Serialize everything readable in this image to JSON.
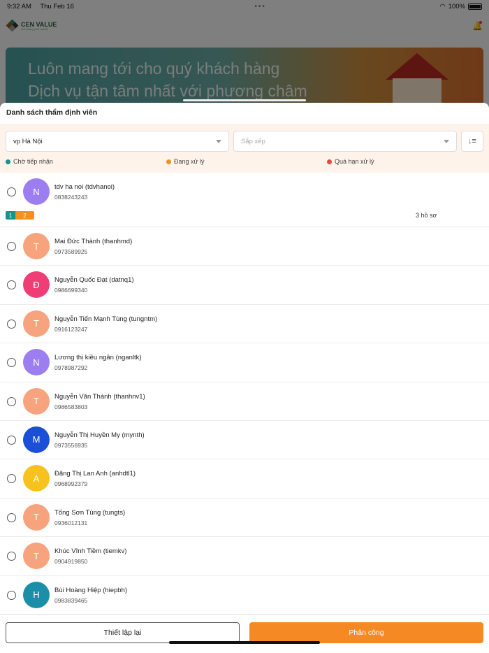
{
  "status_bar": {
    "time": "9:32 AM",
    "date": "Thu Feb 16",
    "battery": "100%"
  },
  "app": {
    "logo_name": "CEN VALUE",
    "logo_tagline": "Unlocking your assets",
    "banner_line1": "Luôn mang tới cho quý khách hàng",
    "banner_line2": "Dịch vụ tận tâm nhất với phương châm"
  },
  "sheet": {
    "title": "Danh sách thẩm định viên",
    "office_select": "vp Hà Nội",
    "sort_placeholder": "Sắp xếp",
    "legend": [
      {
        "label": "Chờ tiếp nhận",
        "color": "#14948e"
      },
      {
        "label": "Đang xử lý",
        "color": "#f5901e"
      },
      {
        "label": "Quá hạn xử lý",
        "color": "#e8473d"
      }
    ]
  },
  "appraisers": [
    {
      "initial": "N",
      "color": "#9c7ef0",
      "name": "tdv ha noi (tdvhanoi)",
      "phone": "0838243243",
      "pending": "1",
      "processing": "2",
      "files": "3 hồ sơ"
    },
    {
      "initial": "T",
      "color": "#f7a37d",
      "name": "Mai Đức Thành (thanhmd)",
      "phone": "0973589925"
    },
    {
      "initial": "Đ",
      "color": "#ee3e75",
      "name": "Nguyễn Quốc Đạt (datnq1)",
      "phone": "0986699340"
    },
    {
      "initial": "T",
      "color": "#f7a37d",
      "name": "Nguyễn Tiến Mạnh Tùng (tungntm)",
      "phone": "0916123247"
    },
    {
      "initial": "N",
      "color": "#9c7ef0",
      "name": "Lương thị kiều ngân (nganltk)",
      "phone": "0978987292"
    },
    {
      "initial": "T",
      "color": "#f7a37d",
      "name": "Nguyễn Văn Thành (thanhnv1)",
      "phone": "0986583803"
    },
    {
      "initial": "M",
      "color": "#1a4fd6",
      "name": "Nguyễn Thị Huyền My (mynth)",
      "phone": "0973556935"
    },
    {
      "initial": "A",
      "color": "#f7c21e",
      "name": "Đặng Thị Lan Anh (anhdtl1)",
      "phone": "0968992379"
    },
    {
      "initial": "T",
      "color": "#f7a37d",
      "name": "Tống Sơn Tùng (tungts)",
      "phone": "0936012131"
    },
    {
      "initial": "T",
      "color": "#f7a37d",
      "name": "Khúc Vĩnh Tiềm (tiemkv)",
      "phone": "0904919850"
    },
    {
      "initial": "H",
      "color": "#1b8fa8",
      "name": "Bùi Hoàng Hiệp (hiepbh)",
      "phone": "0983839465"
    }
  ],
  "footer": {
    "reset_label": "Thiết lập lại",
    "assign_label": "Phân công"
  }
}
